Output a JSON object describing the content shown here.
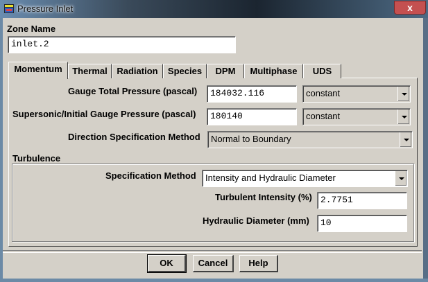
{
  "window": {
    "title": "Pressure Inlet",
    "close_label": "x"
  },
  "zone": {
    "label": "Zone Name",
    "value": "inlet.2"
  },
  "tabs": [
    {
      "label": "Momentum"
    },
    {
      "label": "Thermal"
    },
    {
      "label": "Radiation"
    },
    {
      "label": "Species"
    },
    {
      "label": "DPM"
    },
    {
      "label": "Multiphase"
    },
    {
      "label": "UDS"
    }
  ],
  "momentum": {
    "gauge_total_pressure": {
      "label": "Gauge Total Pressure (pascal)",
      "value": "184032.116",
      "method": "constant"
    },
    "supersonic_pressure": {
      "label": "Supersonic/Initial Gauge Pressure (pascal)",
      "value": "180140",
      "method": "constant"
    },
    "direction": {
      "label": "Direction Specification Method",
      "value": "Normal to Boundary"
    }
  },
  "turbulence": {
    "heading": "Turbulence",
    "spec_method": {
      "label": "Specification Method",
      "value": "Intensity and Hydraulic Diameter"
    },
    "intensity": {
      "label": "Turbulent Intensity (%)",
      "value": "2.7751"
    },
    "hydraulic_diameter": {
      "label": "Hydraulic Diameter (mm)",
      "value": "10"
    }
  },
  "buttons": {
    "ok": "OK",
    "cancel": "Cancel",
    "help": "Help"
  }
}
